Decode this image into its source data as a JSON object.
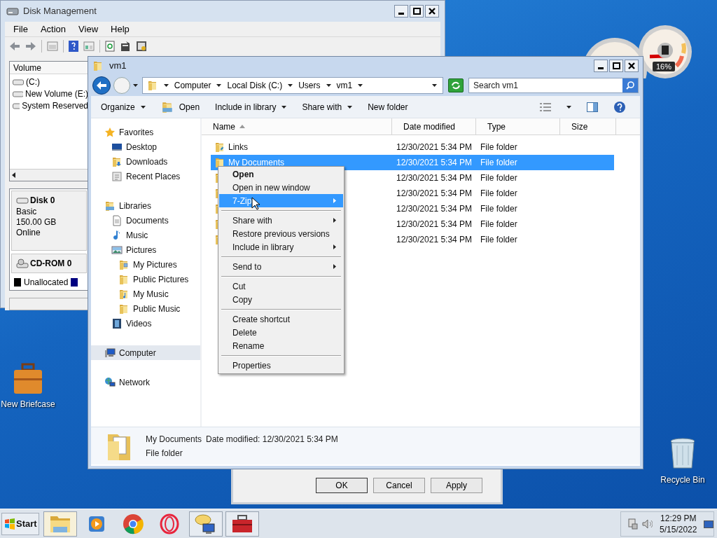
{
  "desktop_icons": [
    {
      "label": "New Briefcase",
      "kind": "briefcase"
    },
    {
      "label": "Recycle Bin",
      "kind": "recycle"
    }
  ],
  "gadget": {
    "reading": "16%"
  },
  "disk_management": {
    "title": "Disk Management",
    "menu": [
      "File",
      "Action",
      "View",
      "Help"
    ],
    "volume_header": "Volume",
    "volumes": [
      "(C:)",
      "New Volume (E:)",
      "System Reserved"
    ],
    "disks": [
      {
        "name": "Disk 0",
        "kind": "hdd",
        "lines": [
          "Basic",
          "150.00 GB",
          "Online"
        ]
      },
      {
        "name": "CD-ROM 0",
        "kind": "cdrom"
      }
    ],
    "legend": [
      {
        "label": "Unallocated",
        "color": "#000000"
      },
      {
        "color": "#000080"
      }
    ]
  },
  "dialog": {
    "buttons": [
      "OK",
      "Cancel",
      "Apply"
    ]
  },
  "explorer": {
    "title": "vm1",
    "breadcrumb": [
      "Computer",
      "Local Disk (C:)",
      "Users",
      "vm1"
    ],
    "search": {
      "placeholder": "Search vm1"
    },
    "toolbar": [
      {
        "label": "Organize",
        "kind": "menu"
      },
      {
        "label": "Open",
        "kind": "icon"
      },
      {
        "label": "Include in library",
        "kind": "menu"
      },
      {
        "label": "Share with",
        "kind": "menu"
      },
      {
        "label": "New folder",
        "kind": "plain"
      }
    ],
    "nav": [
      {
        "label": "Favorites",
        "kind": "star",
        "selected": false,
        "children": [
          {
            "label": "Desktop",
            "kind": "desktop",
            "selected": false
          },
          {
            "label": "Downloads",
            "kind": "downloads",
            "selected": false
          },
          {
            "label": "Recent Places",
            "kind": "recent",
            "selected": false
          }
        ]
      },
      {
        "label": "Libraries",
        "kind": "library",
        "selected": false,
        "children": [
          {
            "label": "Documents",
            "kind": "documents",
            "selected": false
          },
          {
            "label": "Music",
            "kind": "music",
            "selected": false
          },
          {
            "label": "Pictures",
            "kind": "pictures",
            "selected": false,
            "children": [
              {
                "label": "My Pictures",
                "kind": "picture_folder",
                "selected": false
              },
              {
                "label": "Public Pictures",
                "kind": "folder",
                "selected": false
              },
              {
                "label": "My Music",
                "kind": "music_folder",
                "selected": false
              },
              {
                "label": "Public Music",
                "kind": "folder",
                "selected": false
              }
            ]
          },
          {
            "label": "Videos",
            "kind": "videos",
            "selected": false
          }
        ]
      },
      {
        "label": "Computer",
        "kind": "computer",
        "selected": true
      },
      {
        "label": "Network",
        "kind": "network",
        "selected": false
      }
    ],
    "columns": [
      {
        "label": "Name",
        "sorted": true
      },
      {
        "label": "Date modified",
        "sorted": false
      },
      {
        "label": "Type",
        "sorted": false
      },
      {
        "label": "Size",
        "sorted": false
      }
    ],
    "rows": [
      {
        "name": "Links",
        "date": "12/30/2021 5:34 PM",
        "type": "File folder",
        "selected": false
      },
      {
        "name": "My Documents",
        "date": "12/30/2021 5:34 PM",
        "type": "File folder",
        "selected": true
      },
      {
        "date": "12/30/2021 5:34 PM",
        "type": "File folder",
        "selected": false
      },
      {
        "date": "12/30/2021 5:34 PM",
        "type": "File folder",
        "selected": false
      },
      {
        "date": "12/30/2021 5:34 PM",
        "type": "File folder",
        "selected": false
      },
      {
        "date": "12/30/2021 5:34 PM",
        "type": "File folder",
        "selected": false
      },
      {
        "date": "12/30/2021 5:34 PM",
        "type": "File folder",
        "selected": false
      }
    ],
    "details": {
      "name": "My Documents",
      "date_label": "Date modified:",
      "date": "12/30/2021 5:34 PM",
      "type": "File folder"
    }
  },
  "context_menu": {
    "groups": [
      {
        "items": [
          {
            "label": "Open",
            "bold": true,
            "submenu": false,
            "selected": false
          },
          {
            "label": "Open in new window",
            "bold": false,
            "submenu": false,
            "selected": false
          },
          {
            "label": "7-Zip",
            "bold": false,
            "submenu": true,
            "selected": true
          }
        ]
      },
      {
        "items": [
          {
            "label": "Share with",
            "bold": false,
            "submenu": true,
            "selected": false
          },
          {
            "label": "Restore previous versions",
            "bold": false,
            "submenu": false,
            "selected": false
          },
          {
            "label": "Include in library",
            "bold": false,
            "submenu": true,
            "selected": false
          }
        ]
      },
      {
        "items": [
          {
            "label": "Send to",
            "bold": false,
            "submenu": true,
            "selected": false
          }
        ]
      },
      {
        "items": [
          {
            "label": "Cut",
            "bold": false,
            "submenu": false,
            "selected": false
          },
          {
            "label": "Copy",
            "bold": false,
            "submenu": false,
            "selected": false
          }
        ]
      },
      {
        "items": [
          {
            "label": "Create shortcut",
            "bold": false,
            "submenu": false,
            "selected": false
          },
          {
            "label": "Delete",
            "bold": false,
            "submenu": false,
            "selected": false
          },
          {
            "label": "Rename",
            "bold": false,
            "submenu": false,
            "selected": false
          }
        ]
      },
      {
        "items": [
          {
            "label": "Properties",
            "bold": false,
            "submenu": false,
            "selected": false
          }
        ]
      }
    ]
  },
  "taskbar": {
    "start": "Start",
    "apps": [
      {
        "kind": "explorer",
        "open": true,
        "selected": true
      },
      {
        "kind": "media",
        "open": false,
        "selected": false
      },
      {
        "kind": "chrome",
        "open": false,
        "selected": false
      },
      {
        "kind": "opera",
        "open": false,
        "selected": false
      },
      {
        "kind": "chat",
        "open": true,
        "selected": false
      },
      {
        "kind": "toolbox",
        "open": true,
        "selected": false
      }
    ],
    "time": "12:29 PM",
    "date": "5/15/2022"
  }
}
